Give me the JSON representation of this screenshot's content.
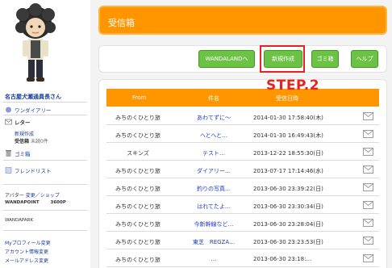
{
  "sidebar": {
    "user_name": "名古屋犬瀬通員長さん",
    "diary": "ワンダイアリー",
    "letter": "レター",
    "new_compose": "新規作成",
    "inbox_prefix": "受信箱",
    "inbox_status": "未読0件",
    "trash": "ゴミ箱",
    "friends": "フレンドリスト",
    "avatar_label": "アバター",
    "avatar_change": "変更",
    "avatar_shop": "ショップ",
    "points_label": "WANDAPOINT",
    "points_value": "3600P",
    "park": "WANDAPARK",
    "profile_edit": "Myプロフィール変更",
    "account_edit": "アカウント情報変更",
    "mail_edit": "メールアドレス変更"
  },
  "header": {
    "title": "受信箱"
  },
  "buttons": {
    "wandaland": "WANDALANDへ",
    "new": "新規作成",
    "trash": "ゴミ箱",
    "help": "ヘルプ"
  },
  "step_label": "STEP.2",
  "table": {
    "col_from": "From",
    "col_subject": "件名",
    "col_date": "受信日時",
    "rows": [
      {
        "from": "みちのくひとり旅",
        "subject": "あわてずに～",
        "date": "2014-01-30 17:58:40(木)"
      },
      {
        "from": "みちのくひとり旅",
        "subject": "へとへと…",
        "date": "2014-01-30 16:49:43(木)"
      },
      {
        "from": "スキンズ",
        "subject": "テスト…",
        "date": "2013-12-22 18:55:30(日)"
      },
      {
        "from": "みちのくひとり旅",
        "subject": "ダイアリー…",
        "date": "2013-07-17 17:14:46(水)"
      },
      {
        "from": "みちのくひとり旅",
        "subject": "釣りの写真…",
        "date": "2013-06-30 23:39:22(日)"
      },
      {
        "from": "みちのくひとり旅",
        "subject": "はれてたよ…",
        "date": "2013-06-30 23:30:34(日)"
      },
      {
        "from": "みちのくひとり旅",
        "subject": "今新幹線など…",
        "date": "2013-06-30 23:28:04(日)"
      },
      {
        "from": "みちのくひとり旅",
        "subject": "東芝　REGZA…",
        "date": "2013-06-30 23:23:53(日)"
      },
      {
        "from": "みちのくひとり旅",
        "subject": "…",
        "date": "2013-06-30 23:18:…"
      }
    ]
  },
  "colors": {
    "accent": "#ff9600",
    "button_green": "#6cc244",
    "step_red": "#e8231f",
    "link": "#1a3c9a"
  },
  "icons": [
    "diary-icon",
    "letter-icon",
    "trash-icon",
    "friend-list-icon",
    "envelope-icon"
  ]
}
